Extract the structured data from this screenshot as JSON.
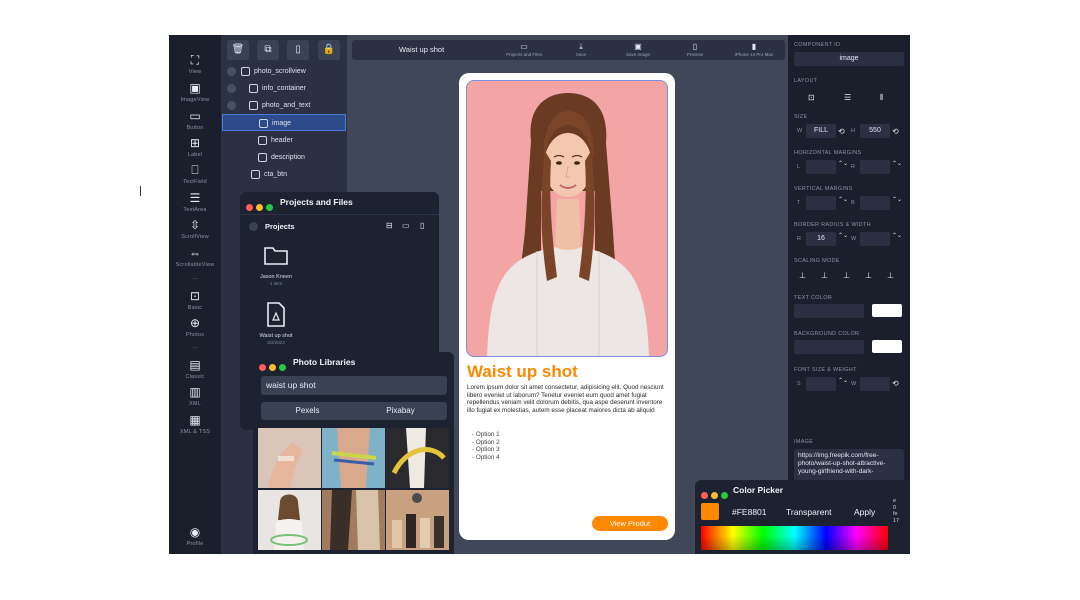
{
  "toolbar": {
    "items": [
      {
        "label": "View",
        "icon": "view-icon"
      },
      {
        "label": "ImageView",
        "icon": "imageview-icon"
      },
      {
        "label": "Button",
        "icon": "button-icon"
      },
      {
        "label": "Label",
        "icon": "label-icon"
      },
      {
        "label": "TextField",
        "icon": "textfield-icon"
      },
      {
        "label": "TextArea",
        "icon": "textarea-icon"
      },
      {
        "label": "ScrollView",
        "icon": "scrollview-icon"
      },
      {
        "label": "ScrollableView",
        "icon": "scrollableview-icon"
      },
      {
        "label": "Basic",
        "icon": "basic-icon"
      },
      {
        "label": "Photos",
        "icon": "photos-icon"
      },
      {
        "label": "Classic",
        "icon": "classic-icon"
      },
      {
        "label": "XML",
        "icon": "xml-icon"
      },
      {
        "label": "XML & TSS",
        "icon": "xml-tss-icon"
      }
    ],
    "profile_label": "Profile"
  },
  "layers": {
    "actions": [
      "trash-icon",
      "duplicate-icon",
      "paste-icon",
      "lock-icon"
    ],
    "tree": [
      {
        "label": "photo_scrollview",
        "depth": 0
      },
      {
        "label": "info_container",
        "depth": 1
      },
      {
        "label": "photo_and_text",
        "depth": 2
      },
      {
        "label": "image",
        "depth": 3,
        "selected": true
      },
      {
        "label": "header",
        "depth": 3
      },
      {
        "label": "description",
        "depth": 3
      },
      {
        "label": "cta_btn",
        "depth": 2
      }
    ]
  },
  "topbar": {
    "doc_title": "Waist up shot",
    "actions": [
      {
        "label": "Projects and Files",
        "icon": "folder-icon"
      },
      {
        "label": "Save",
        "icon": "save-icon"
      },
      {
        "label": "Save Image",
        "icon": "save-image-icon"
      },
      {
        "label": "Preview",
        "icon": "preview-icon"
      },
      {
        "label": "iPhone 14 Pro Max",
        "icon": "phone-icon"
      }
    ]
  },
  "phone": {
    "title": "Waist up shot",
    "description": "Lorem ipsum dolor sit amet consectetur, adipisicing elit. Quod nesciunt libero eveniet ut laborum? Tenetur eveniet eum quod amet fugiat repellendus veniam velit dolorum debitis, qua aspe deserunt inventore illo fugiat ex molestias, autem esse placeat maiores dicta ab aliquid",
    "options": [
      "- Option 1",
      "- Option 2",
      "- Option 3",
      "- Option 4"
    ],
    "cta_label": "View Produt",
    "accent": "#FE8801",
    "hero_bg": "#F3A5A6"
  },
  "props": {
    "component_id_label": "COMPONENT ID",
    "component_id": "image",
    "layout_label": "LAYOUT",
    "size_label": "SIZE",
    "size_w_label": "W",
    "size_w": "FILL",
    "size_h_label": "H",
    "size_h": "550",
    "hmargins_label": "HORIZONTAL MARGINS",
    "hmargins_l": "L",
    "hmargins_r": "R",
    "vmargins_label": "VERTICAL MARGINS",
    "vmargins_t": "T",
    "vmargins_b": "B",
    "border_label": "BORDER RADIUS & WIDTH",
    "border_r_label": "R",
    "border_r": "16",
    "border_w_label": "W",
    "scaling_label": "SCALING MODE",
    "text_color_label": "TEXT COLOR",
    "bg_color_label": "BACKGROUND COLOR",
    "font_label": "FONT SIZE & WEIGHT",
    "font_s_label": "S",
    "font_w_label": "W",
    "image_label": "IMAGE",
    "image_url": "https://img.freepik.com/free-photo/waist-up-shot-attractive-young-girlfriend-with-dark-"
  },
  "projects": {
    "title": "Projects and Files",
    "section": "Projects",
    "folder_label": "Jason Kneen",
    "folder_sub": "1 item",
    "file_label": "Waist up shot",
    "file_sub": "8/2/2023"
  },
  "photo_libraries": {
    "title": "Photo Libraries",
    "search_value": "waist up shot",
    "tabs": [
      "Pexels",
      "Pixabay"
    ]
  },
  "color_picker": {
    "title": "Color Picker",
    "hex": "#FE8801",
    "transparent_label": "Transparent",
    "apply_label": "Apply",
    "edge_text": "e\n0\nfe\n17"
  },
  "colors": {
    "red_dot": "#FF5F57",
    "yellow_dot": "#FEBC2E",
    "green_dot": "#28C840"
  }
}
